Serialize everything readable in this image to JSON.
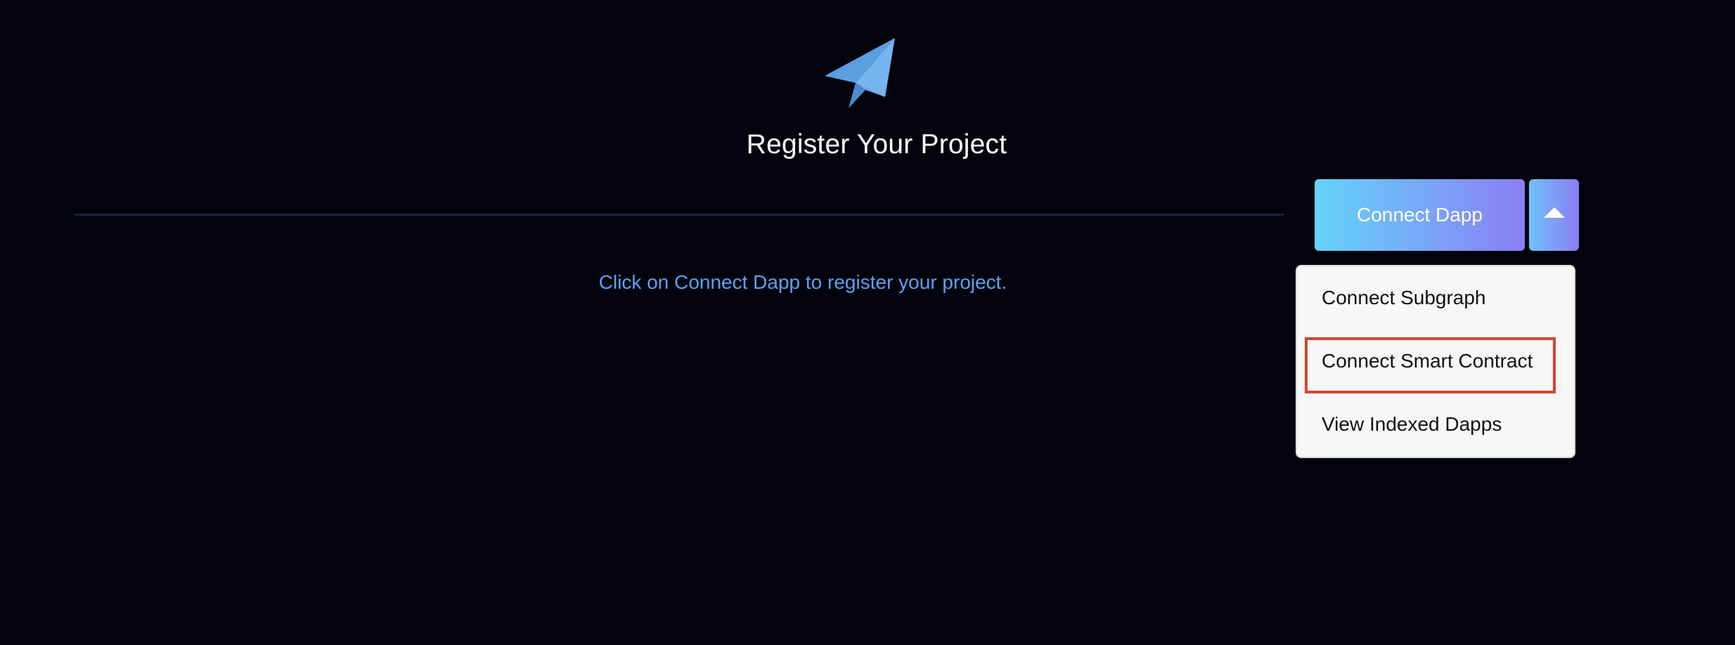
{
  "header": {
    "logo_icon": "paper-plane-icon",
    "title": "Register Your Project"
  },
  "main": {
    "hint": "Click on Connect Dapp to register your project."
  },
  "connect": {
    "button_label": "Connect Dapp",
    "toggle_icon": "caret-up-icon",
    "menu": [
      {
        "label": "Connect Subgraph"
      },
      {
        "label": "Connect Smart Contract",
        "highlighted": true
      },
      {
        "label": "View Indexed Dapps"
      }
    ]
  },
  "colors": {
    "background": "#03030d",
    "hint_text": "#5ea1ee",
    "button_gradient_start": "#63d3fb",
    "button_gradient_end": "#8b7ef3",
    "highlight_border": "#d8442e",
    "menu_background": "#f7f7f7"
  }
}
